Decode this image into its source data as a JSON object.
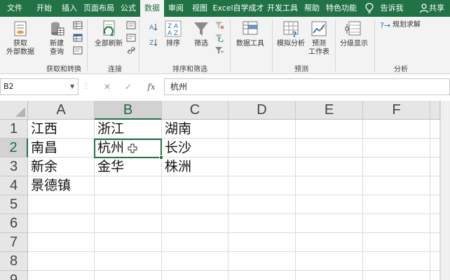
{
  "menu": {
    "tabs": [
      "文件",
      "开始",
      "插入",
      "页面布局",
      "公式",
      "数据",
      "审阅",
      "视图",
      "Excel自学成才",
      "开发工具",
      "帮助",
      "特色功能"
    ],
    "active_tab": "数据",
    "tell_me": "告诉我",
    "share": "共享"
  },
  "ribbon": {
    "get_external": [
      "获取",
      "外部数据"
    ],
    "new_query": [
      "新建",
      "查询"
    ],
    "refresh_all": "全部刷新",
    "sort": "排序",
    "filter": "筛选",
    "data_tools": "数据工具",
    "what_if": "模拟分析",
    "forecast_sheet": [
      "预测",
      "工作表"
    ],
    "outline": "分级显示",
    "solver": "规划求解",
    "groups": {
      "get_transform": "获取和转换",
      "connections": "连接",
      "sort_filter": "排序和筛选",
      "forecast": "预测",
      "analysis": "分析"
    }
  },
  "formula_bar": {
    "name_box": "B2",
    "content": "杭州"
  },
  "grid": {
    "columns": [
      "A",
      "B",
      "C",
      "D",
      "E",
      "F"
    ],
    "rows": [
      "1",
      "2",
      "3",
      "4",
      "5",
      "6",
      "7",
      "8",
      "9"
    ],
    "selected_cell": "B2",
    "cells": {
      "A1": "江西",
      "B1": "浙江",
      "C1": "湖南",
      "A2": "南昌",
      "B2": "杭州",
      "C2": "长沙",
      "A3": "新余",
      "B3": "金华",
      "C3": "株洲",
      "A4": "景德镇"
    }
  },
  "colors": {
    "accent": "#217346"
  }
}
